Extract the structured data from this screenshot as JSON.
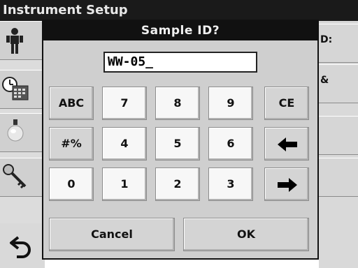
{
  "background": {
    "title": "Instrument Setup",
    "right_items": [
      "D:",
      "&"
    ]
  },
  "dialog": {
    "title": "Sample ID?",
    "entry_value": "WW-05_",
    "keys": {
      "abc": "ABC",
      "symbols": "#%",
      "k0": "0",
      "k1": "1",
      "k2": "2",
      "k3": "3",
      "k4": "4",
      "k5": "5",
      "k6": "6",
      "k7": "7",
      "k8": "8",
      "k9": "9",
      "ce": "CE"
    },
    "cancel_label": "Cancel",
    "ok_label": "OK"
  },
  "icons": [
    "operator-icon",
    "clock-calendar-icon",
    "lamp-icon",
    "key-icon",
    "back-arrow-icon",
    "left-arrow-icon",
    "right-arrow-icon"
  ]
}
